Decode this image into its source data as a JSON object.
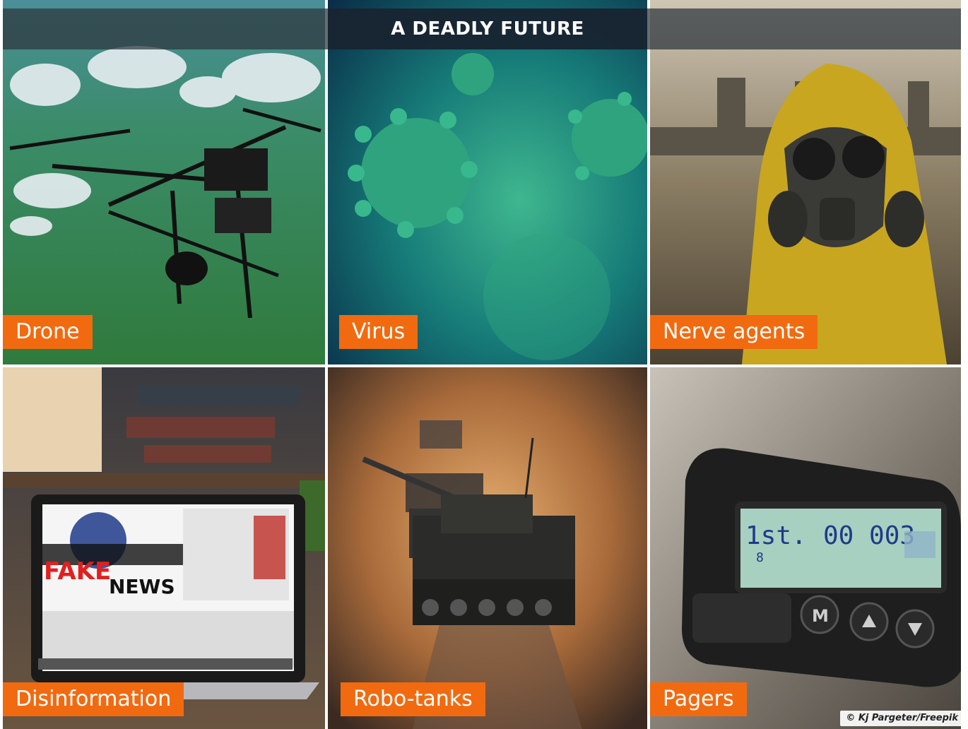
{
  "header": {
    "title": "A DEADLY FUTURE"
  },
  "tiles": [
    {
      "label": "Drone"
    },
    {
      "label": "Virus"
    },
    {
      "label": "Nerve agents"
    },
    {
      "label": "Disinformation"
    },
    {
      "label": "Robo-tanks"
    },
    {
      "label": "Pagers"
    }
  ],
  "laptop_screen": {
    "fake": "FAKE",
    "news": "NEWS"
  },
  "pager_display": {
    "line1_left": "1st.",
    "line1_right": "00 003",
    "line2": "8"
  },
  "credit": "© Kj Pargeter/Freepik",
  "colors": {
    "label_bg": "#f26a10",
    "header_bg": "#16222f",
    "label_text": "#ffffff"
  }
}
